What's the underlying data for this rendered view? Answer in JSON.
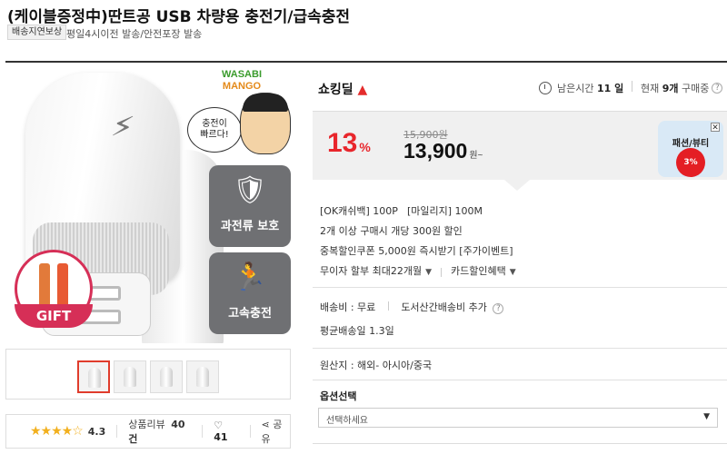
{
  "product": {
    "title": "(케이블증정中)딴트공 USB 차량용 충전기/급속충전",
    "badge": "배송지연보상",
    "ship_note": "평일4시이전 발송/안전포장 발송"
  },
  "hero": {
    "brand_line1": "WASABI",
    "brand_line2": "MANGO",
    "speech": "충전이\n빠르다!",
    "tile1_label": "과전류 보호",
    "tile2_label": "고속충전",
    "gift_label": "GIFT"
  },
  "thumbnails": {
    "count": 4,
    "active_index": 0
  },
  "rating": {
    "stars": 4.3,
    "value": "4.3",
    "reviews_label": "상품리뷰",
    "reviews_count": "40건",
    "likes": "41",
    "share_label": "공유"
  },
  "seller": {
    "logo": "쇼킹딜",
    "time_prefix": "남은시간",
    "time_value": "11 일",
    "buyers_prefix": "현재",
    "buyers_value": "9개",
    "buyers_suffix": "구매중"
  },
  "price": {
    "discount": "13",
    "discount_unit": "%",
    "original": "15,900원",
    "sale": "13,900",
    "sale_unit": "원~"
  },
  "promo": {
    "label": "패션/뷰티",
    "badge": "3%"
  },
  "benefits": {
    "okcash": "[OK캐쉬백] 100P",
    "mileage": "[마일리지] 100M",
    "multi": "2개 이상 구매시 개당 300원 할인",
    "coupon": "중복할인쿠폰 5,000원 즉시받기 [주가이벤트]",
    "installment": "무이자 할부 최대22개월",
    "card": "카드할인혜택"
  },
  "shipping": {
    "fee": "배송비 : 무료",
    "remote": "도서산간배송비 추가",
    "avg": "평균배송일 1.3일"
  },
  "origin": "원산지 : 해외- 아시아/중국",
  "options": {
    "title": "옵션선택",
    "placeholder": "선택하세요"
  },
  "colors": {
    "accent_red": "#e8262c",
    "star": "#f2b01e",
    "price_panel_bg": "#f0f0f0",
    "gift": "#d62f57"
  }
}
